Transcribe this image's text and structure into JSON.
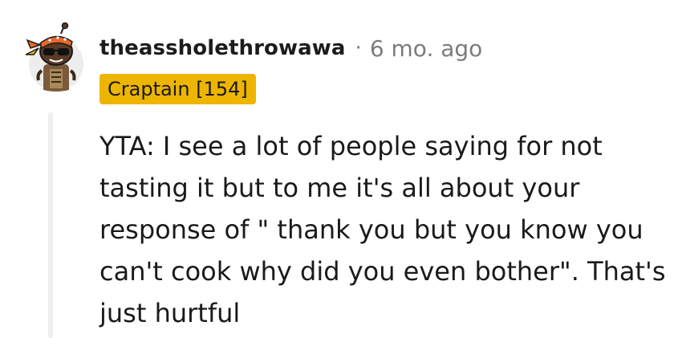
{
  "comment": {
    "username": "theassholethrowawa",
    "separator": "·",
    "timestamp": "6 mo. ago",
    "flair": "Craptain [154]",
    "body": "YTA: I see a lot of people saying for not tasting it but to me it's all about your response of \" thank you but you know you can't cook why did you even bother\". That's just hurtful"
  },
  "colors": {
    "flair_background": "#edb500",
    "username": "#1c1c1c",
    "timestamp": "#7c7c7c",
    "thread_line": "#edeff1"
  },
  "icons": {
    "avatar": "snoo-avatar-with-bandana-and-sunglasses"
  }
}
